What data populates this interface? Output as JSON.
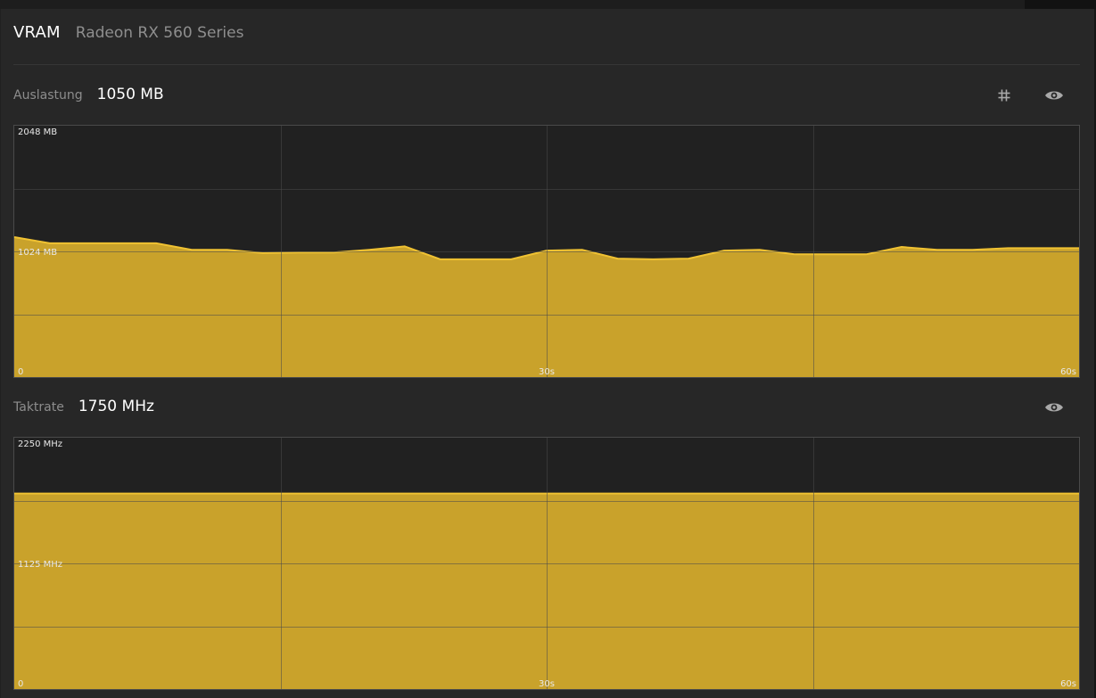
{
  "header": {
    "title": "VRAM",
    "device": "Radeon RX 560 Series"
  },
  "usage": {
    "label": "Auslastung",
    "value": "1050 MB"
  },
  "clock": {
    "label": "Taktrate",
    "value": "1750 MHz"
  },
  "icons": {
    "grid": "hash-icon",
    "visibility": "eye-icon"
  },
  "colors": {
    "fill": "#c9a22b",
    "line": "#f0c232",
    "panel": "#272727",
    "plot": "#212121",
    "grid": "#4a4a4a"
  },
  "chart_data": [
    {
      "type": "area",
      "ymax_label": "2048 MB",
      "ymid_label": "1024 MB",
      "x_labels": [
        "0",
        "30s",
        "60s"
      ],
      "ylim": [
        0,
        2048
      ],
      "xlim": [
        0,
        60
      ],
      "series": [
        {
          "x": [
            0,
            2,
            4,
            6,
            8,
            10,
            12,
            14,
            16,
            18,
            20,
            22,
            24,
            26,
            28,
            30,
            32,
            34,
            36,
            38,
            40,
            42,
            44,
            46,
            48,
            50,
            52,
            54,
            56,
            58,
            60
          ],
          "values": [
            1140,
            1090,
            1090,
            1090,
            1090,
            1037,
            1037,
            1010,
            1015,
            1015,
            1037,
            1065,
            960,
            960,
            960,
            1030,
            1037,
            965,
            960,
            965,
            1030,
            1037,
            1000,
            1000,
            1000,
            1060,
            1037,
            1037,
            1050,
            1050,
            1050
          ]
        }
      ]
    },
    {
      "type": "area",
      "ymax_label": "2250 MHz",
      "ymid_label": "1125 MHz",
      "x_labels": [
        "0",
        "30s",
        "60s"
      ],
      "ylim": [
        0,
        2250
      ],
      "xlim": [
        0,
        60
      ],
      "series": [
        {
          "x": [
            0,
            60
          ],
          "values": [
            1750,
            1750
          ]
        }
      ]
    }
  ]
}
